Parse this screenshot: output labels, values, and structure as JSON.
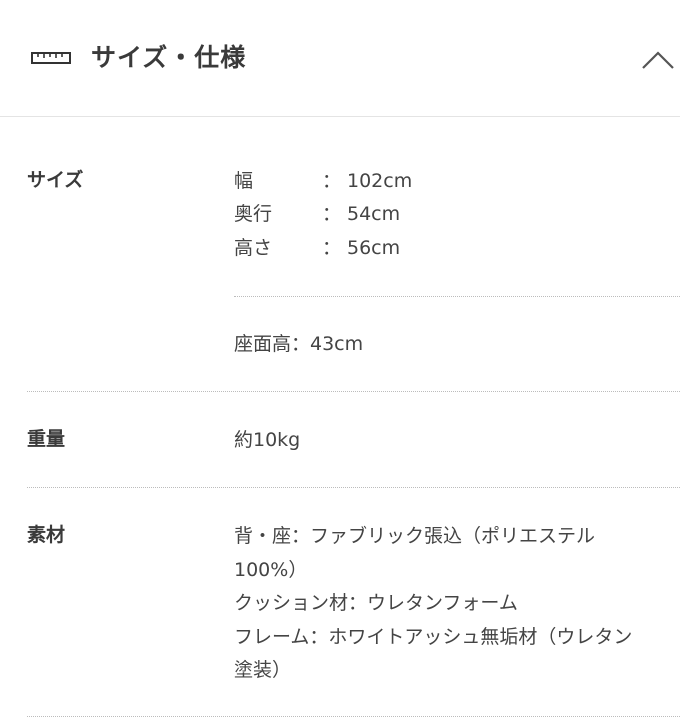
{
  "section": {
    "title": "サイズ・仕様",
    "icon": "ruler-icon",
    "toggle_icon": "chevron-up-icon"
  },
  "size": {
    "label": "サイズ",
    "dimensions": [
      {
        "name": "幅",
        "sep": "：",
        "value": "102cm"
      },
      {
        "name": "奥行",
        "sep": "：",
        "value": "54cm"
      },
      {
        "name": "高さ",
        "sep": "：",
        "value": "56cm"
      }
    ],
    "seat_height": "座面高：43cm"
  },
  "weight": {
    "label": "重量",
    "value": "約10kg"
  },
  "material": {
    "label": "素材",
    "lines": [
      "背・座：ファブリック張込（ポリエステル",
      "100%）",
      "クッション材：ウレタンフォーム",
      "フレーム：ホワイトアッシュ無垢材（ウレタン",
      "塗装）"
    ]
  },
  "colors": {
    "text": "#333333",
    "divider": "#e4e4e4",
    "dotted": "#bcbcbc"
  }
}
